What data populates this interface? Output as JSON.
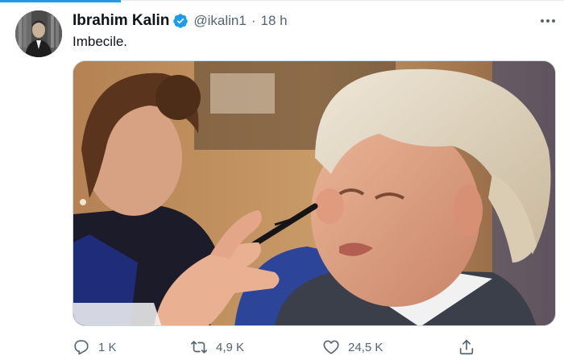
{
  "tweet": {
    "author": {
      "name": "Ibrahim Kalin",
      "handle": "@ikalin1",
      "avatar_icon": "user-avatar",
      "verified_icon": "verified-badge-icon"
    },
    "separator": "·",
    "time": "18 h",
    "text": "Imbecile.",
    "media": {
      "kind": "photo",
      "description_icon": "photo"
    },
    "actions": {
      "reply": {
        "icon": "reply-icon",
        "count": "1 K"
      },
      "retweet": {
        "icon": "retweet-icon",
        "count": "4,9 K"
      },
      "like": {
        "icon": "heart-icon",
        "count": "24,5 K"
      },
      "share": {
        "icon": "share-icon"
      }
    },
    "more_icon": "more-options-icon"
  },
  "colors": {
    "accent": "#1d9bf0",
    "text_primary": "#0f1419",
    "text_secondary": "#536471",
    "border": "#cfd9de"
  }
}
